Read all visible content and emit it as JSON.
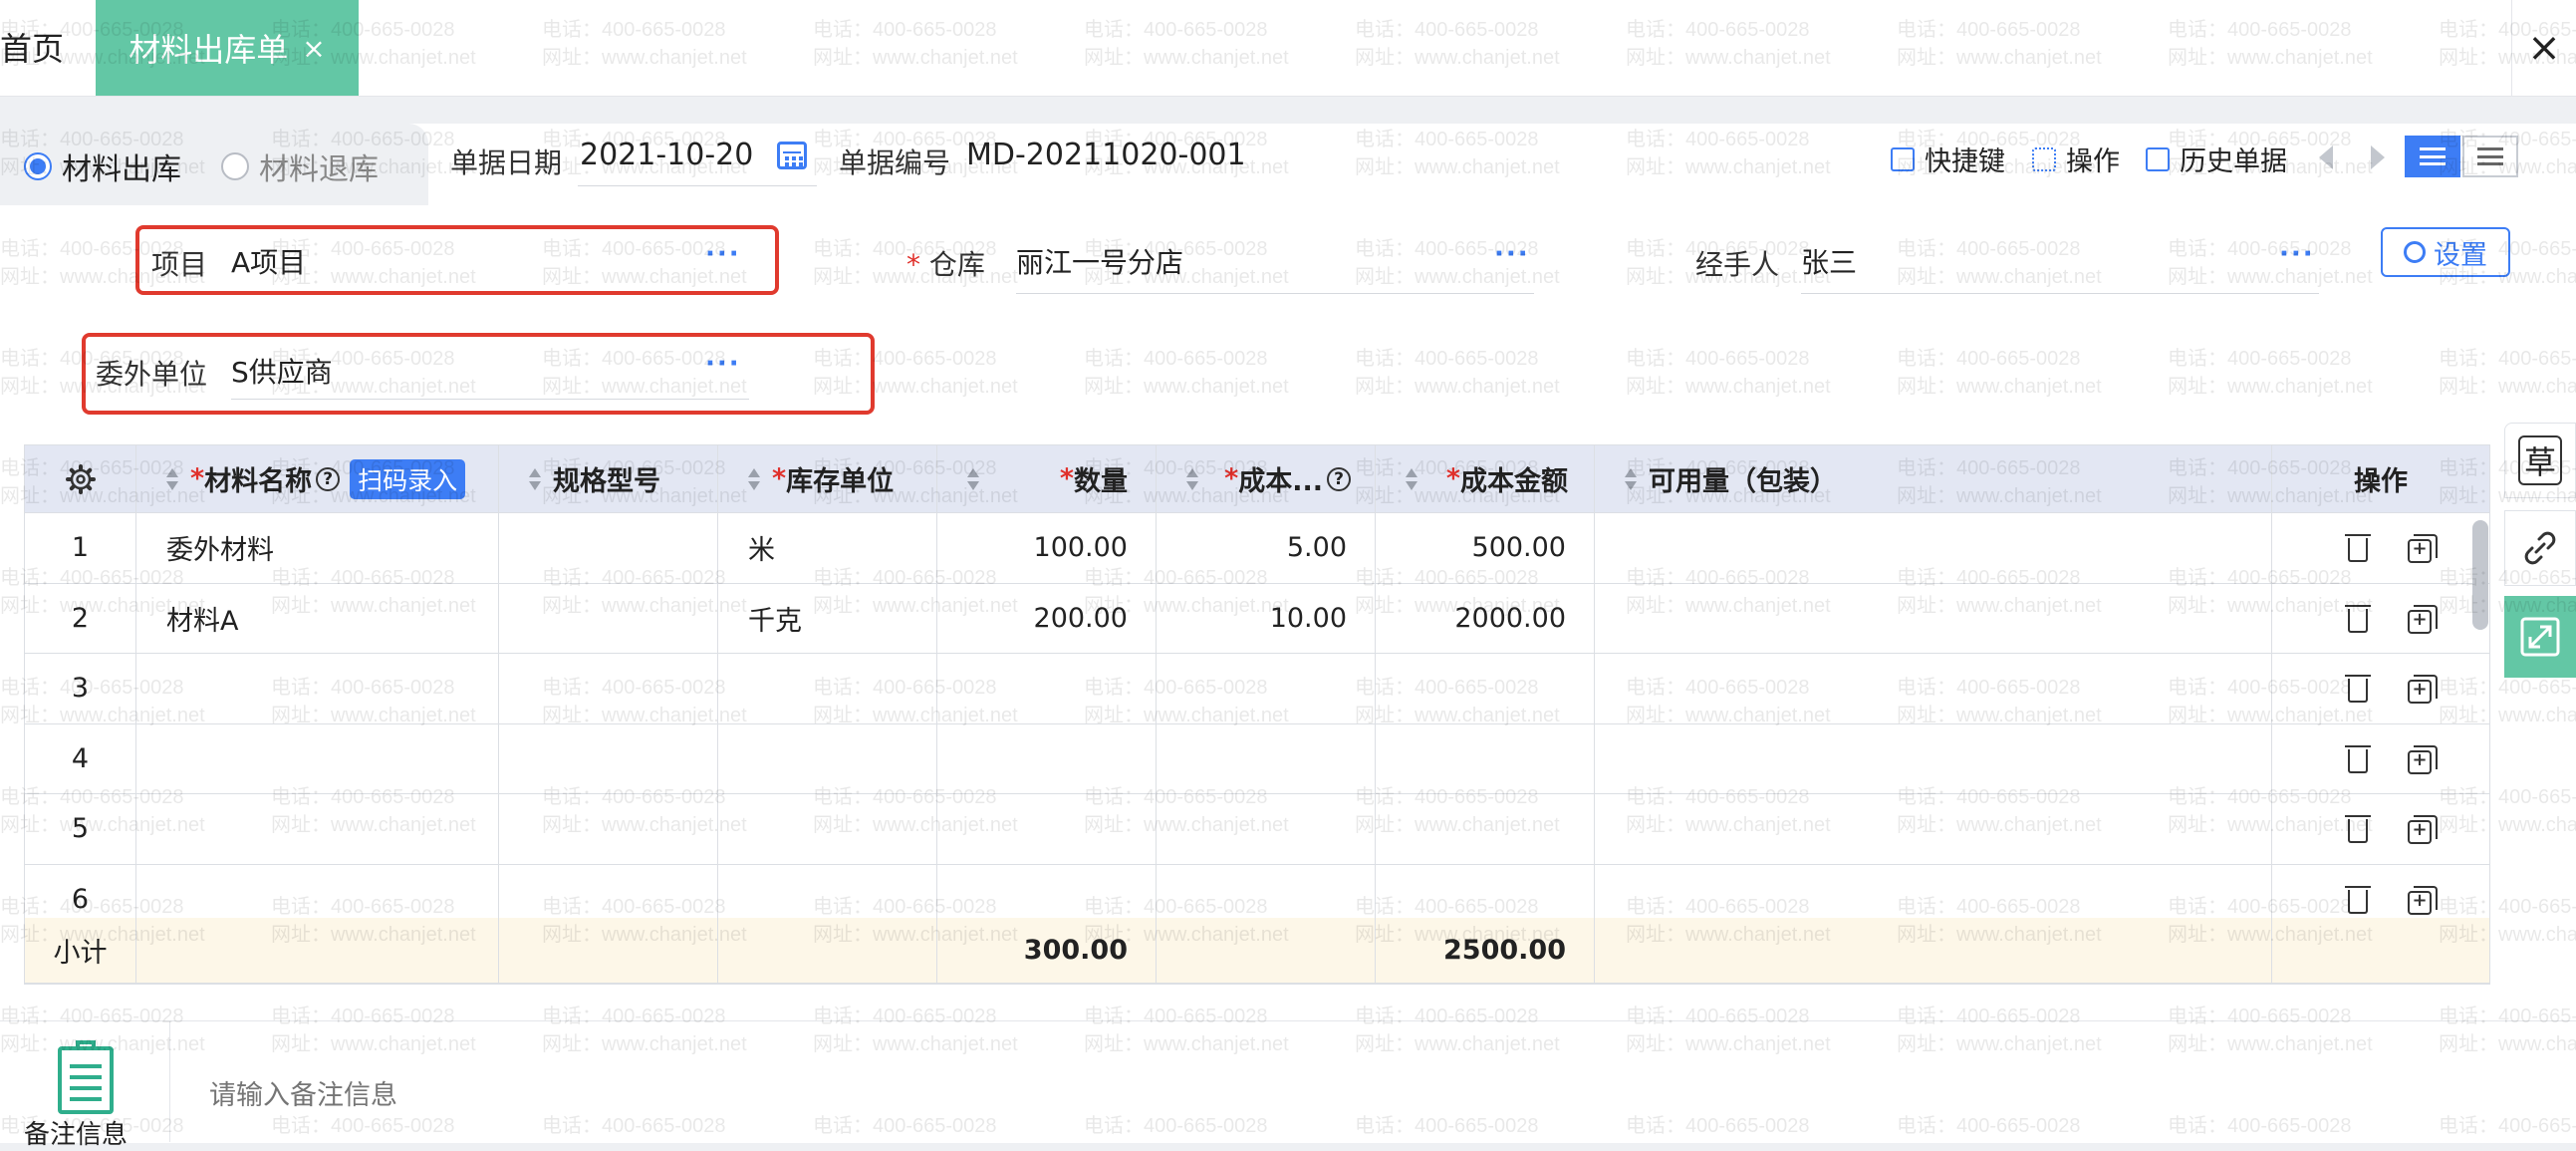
{
  "tabs": {
    "home": "首页",
    "active": "材料出库单",
    "active_close": "×",
    "window_close": "×"
  },
  "mode": {
    "out_label": "材料出库",
    "return_label": "材料退库",
    "selected": "out"
  },
  "header": {
    "date_label": "单据日期",
    "date_value": "2021-10-20",
    "number_label": "单据编号",
    "number_value": "MD-20211020-001"
  },
  "toolbar": {
    "shortcut_label": "快捷键",
    "operation_label": "操作",
    "history_label": "历史单据",
    "settings_label": "设置"
  },
  "form": {
    "project_label": "项目",
    "project_value": "A项目",
    "warehouse_required": "*",
    "warehouse_label": "仓库",
    "warehouse_value": "丽江一号分店",
    "handler_label": "经手人",
    "handler_value": "张三",
    "outsource_label": "委外单位",
    "outsource_value": "S供应商",
    "more": "···"
  },
  "table": {
    "columns": {
      "material_name": "材料名称",
      "scan_entry": "扫码录入",
      "spec": "规格型号",
      "unit": "库存单位",
      "quantity": "数量",
      "cost": "成本...",
      "cost_amount": "成本金额",
      "available": "可用量（包装）",
      "actions": "操作",
      "required": "*"
    },
    "rows": [
      {
        "no": "1",
        "name": "委外材料",
        "spec": "",
        "unit": "米",
        "qty": "100.00",
        "cost": "5.00",
        "amount": "500.00",
        "avail": ""
      },
      {
        "no": "2",
        "name": "材料A",
        "spec": "",
        "unit": "千克",
        "qty": "200.00",
        "cost": "10.00",
        "amount": "2000.00",
        "avail": ""
      },
      {
        "no": "3",
        "name": "",
        "spec": "",
        "unit": "",
        "qty": "",
        "cost": "",
        "amount": "",
        "avail": ""
      },
      {
        "no": "4",
        "name": "",
        "spec": "",
        "unit": "",
        "qty": "",
        "cost": "",
        "amount": "",
        "avail": ""
      },
      {
        "no": "5",
        "name": "",
        "spec": "",
        "unit": "",
        "qty": "",
        "cost": "",
        "amount": "",
        "avail": ""
      },
      {
        "no": "6",
        "name": "",
        "spec": "",
        "unit": "",
        "qty": "",
        "cost": "",
        "amount": "",
        "avail": ""
      }
    ],
    "subtotal": {
      "label": "小计",
      "qty": "300.00",
      "amount": "2500.00"
    }
  },
  "side": {
    "draft_label": "草"
  },
  "note": {
    "label": "备注信息",
    "placeholder": "请输入备注信息"
  },
  "watermark": {
    "phone": "电话：400-665-0028",
    "site": "网址：www.chanjet.net"
  },
  "colors": {
    "accent": "#3d7df5",
    "tab_active": "#63c7a5",
    "highlight_box": "#e03a2e",
    "subtotal_bg": "#fdf7e8"
  }
}
